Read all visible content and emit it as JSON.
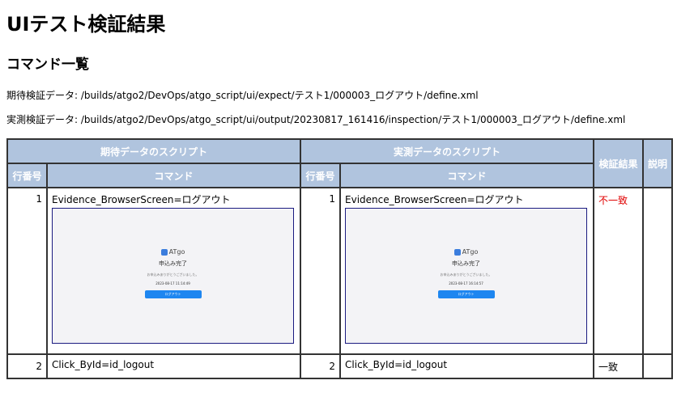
{
  "page_title": "UIテスト検証結果",
  "section_title": "コマンド一覧",
  "paths": {
    "expected": "期待検証データ: /builds/atgo2/DevOps/atgo_script/ui/expect/テスト1/000003_ログアウト/define.xml",
    "actual": "実測検証データ: /builds/atgo2/DevOps/atgo_script/ui/output/20230817_161416/inspection/テスト1/000003_ログアウト/define.xml"
  },
  "table": {
    "headers": {
      "expected_script": "期待データのスクリプト",
      "actual_script": "実測データのスクリプト",
      "verification_result": "検証結果",
      "description": "説明",
      "line_no": "行番号",
      "command": "コマンド"
    },
    "rows": [
      {
        "exp_no": "1",
        "exp_cmd": "Evidence_BrowserScreen=ログアウト",
        "act_no": "1",
        "act_cmd": "Evidence_BrowserScreen=ログアウト",
        "result": "不一致",
        "description": ""
      },
      {
        "exp_no": "2",
        "exp_cmd": "Click_ById=id_logout",
        "act_no": "2",
        "act_cmd": "Click_ById=id_logout",
        "result": "一致",
        "description": ""
      }
    ]
  },
  "screenshot": {
    "logo": "ATgo",
    "status": "申込み完了",
    "message": "お申込みありがとうございました。",
    "expected_time": "2023-08-17 11:14:49",
    "actual_time": "2023-08-17 16:14:57",
    "button": "ログアウト"
  },
  "colors": {
    "header_bg": "#b0c4de",
    "mismatch": "#e00000",
    "screenshot_button": "#1e86f0"
  }
}
